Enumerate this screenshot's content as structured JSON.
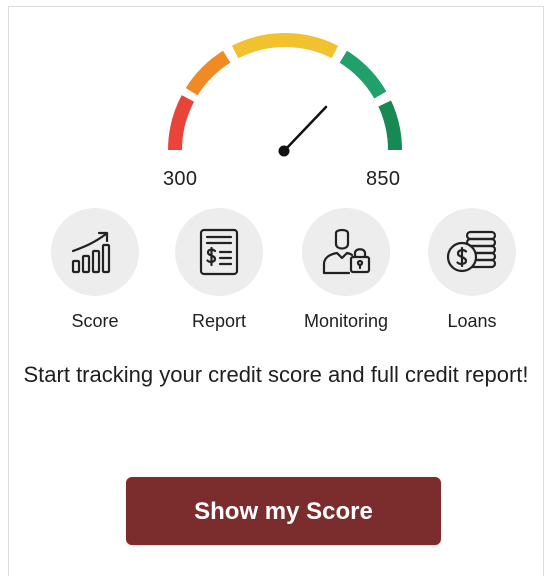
{
  "gauge": {
    "min_label": "300",
    "max_label": "850"
  },
  "features": [
    {
      "label": "Score",
      "icon": "bar-chart-trend-icon"
    },
    {
      "label": "Report",
      "icon": "dollar-document-icon"
    },
    {
      "label": "Monitoring",
      "icon": "user-lock-icon"
    },
    {
      "label": "Loans",
      "icon": "coin-stack-icon"
    }
  ],
  "tagline": "Start tracking your credit score and full credit report!",
  "cta": {
    "label": "Show my Score"
  },
  "colors": {
    "red": "#e8443a",
    "orange": "#f08a24",
    "yellow": "#f2c12e",
    "green_light": "#22a06b",
    "green_dark": "#168a52",
    "cta_bg": "#7b2d2d",
    "icon_circle": "#ededed"
  }
}
